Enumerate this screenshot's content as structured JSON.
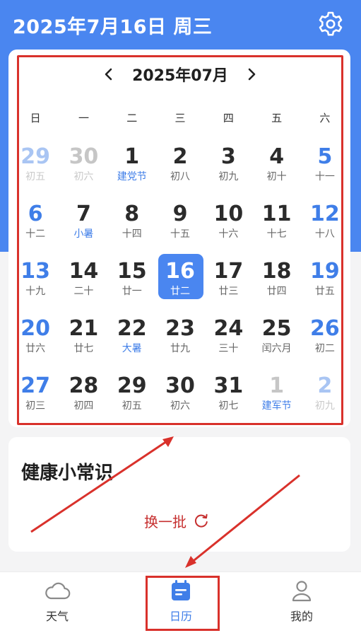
{
  "header": {
    "date_title": "2025年7月16日 周三",
    "settings_icon": "gear-icon",
    "background_color": "#4a86f0"
  },
  "calendar": {
    "month_label": "2025年07月",
    "prev_icon": "chevron-left-icon",
    "next_icon": "chevron-right-icon",
    "weekdays": [
      "日",
      "一",
      "二",
      "三",
      "四",
      "五",
      "六"
    ],
    "weeks": [
      [
        {
          "day": "29",
          "lunar": "初五",
          "faded": true,
          "festival": false
        },
        {
          "day": "30",
          "lunar": "初六",
          "faded": true,
          "festival": false
        },
        {
          "day": "1",
          "lunar": "建党节",
          "faded": false,
          "festival": true
        },
        {
          "day": "2",
          "lunar": "初八",
          "faded": false,
          "festival": false
        },
        {
          "day": "3",
          "lunar": "初九",
          "faded": false,
          "festival": false
        },
        {
          "day": "4",
          "lunar": "初十",
          "faded": false,
          "festival": false
        },
        {
          "day": "5",
          "lunar": "十一",
          "faded": false,
          "festival": false
        }
      ],
      [
        {
          "day": "6",
          "lunar": "十二",
          "faded": false,
          "festival": false
        },
        {
          "day": "7",
          "lunar": "小暑",
          "faded": false,
          "festival": true
        },
        {
          "day": "8",
          "lunar": "十四",
          "faded": false,
          "festival": false
        },
        {
          "day": "9",
          "lunar": "十五",
          "faded": false,
          "festival": false
        },
        {
          "day": "10",
          "lunar": "十六",
          "faded": false,
          "festival": false
        },
        {
          "day": "11",
          "lunar": "十七",
          "faded": false,
          "festival": false
        },
        {
          "day": "12",
          "lunar": "十八",
          "faded": false,
          "festival": false
        }
      ],
      [
        {
          "day": "13",
          "lunar": "十九",
          "faded": false,
          "festival": false
        },
        {
          "day": "14",
          "lunar": "二十",
          "faded": false,
          "festival": false
        },
        {
          "day": "15",
          "lunar": "廿一",
          "faded": false,
          "festival": false
        },
        {
          "day": "16",
          "lunar": "廿二",
          "faded": false,
          "festival": false,
          "selected": true
        },
        {
          "day": "17",
          "lunar": "廿三",
          "faded": false,
          "festival": false
        },
        {
          "day": "18",
          "lunar": "廿四",
          "faded": false,
          "festival": false
        },
        {
          "day": "19",
          "lunar": "廿五",
          "faded": false,
          "festival": false
        }
      ],
      [
        {
          "day": "20",
          "lunar": "廿六",
          "faded": false,
          "festival": false
        },
        {
          "day": "21",
          "lunar": "廿七",
          "faded": false,
          "festival": false
        },
        {
          "day": "22",
          "lunar": "大暑",
          "faded": false,
          "festival": true
        },
        {
          "day": "23",
          "lunar": "廿九",
          "faded": false,
          "festival": false
        },
        {
          "day": "24",
          "lunar": "三十",
          "faded": false,
          "festival": false
        },
        {
          "day": "25",
          "lunar": "闰六月",
          "faded": false,
          "festival": false
        },
        {
          "day": "26",
          "lunar": "初二",
          "faded": false,
          "festival": false
        }
      ],
      [
        {
          "day": "27",
          "lunar": "初三",
          "faded": false,
          "festival": false
        },
        {
          "day": "28",
          "lunar": "初四",
          "faded": false,
          "festival": false
        },
        {
          "day": "29",
          "lunar": "初五",
          "faded": false,
          "festival": false
        },
        {
          "day": "30",
          "lunar": "初六",
          "faded": false,
          "festival": false
        },
        {
          "day": "31",
          "lunar": "初七",
          "faded": false,
          "festival": false
        },
        {
          "day": "1",
          "lunar": "建军节",
          "faded": true,
          "festival": true
        },
        {
          "day": "2",
          "lunar": "初九",
          "faded": true,
          "festival": false
        }
      ]
    ],
    "accent_color": "#3f7ee8",
    "highlight_frame_color": "#d9312b"
  },
  "health": {
    "title": "健康小常识",
    "refresh_label": "换一批",
    "refresh_icon": "refresh-icon"
  },
  "tabbar": {
    "tabs": [
      {
        "label": "天气",
        "icon": "cloud-icon",
        "active": false
      },
      {
        "label": "日历",
        "icon": "calendar-icon",
        "active": true
      },
      {
        "label": "我的",
        "icon": "user-icon",
        "active": false
      }
    ]
  }
}
